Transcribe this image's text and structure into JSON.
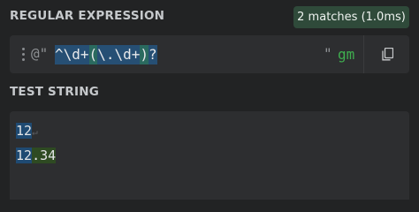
{
  "regex_section": {
    "label": "REGULAR EXPRESSION",
    "match_badge": "2 matches (1.0ms)",
    "delimiter_open": "@\"",
    "expression_tokens": [
      {
        "text": "^",
        "role": "anchor"
      },
      {
        "text": "\\d+",
        "role": "class"
      },
      {
        "text": "(",
        "role": "group"
      },
      {
        "text": "\\.",
        "role": "escape"
      },
      {
        "text": "\\d+",
        "role": "class"
      },
      {
        "text": ")",
        "role": "group"
      },
      {
        "text": "?",
        "role": "quantifier"
      }
    ],
    "delimiter_close": "\"",
    "flags": "gm",
    "copy_icon": "copy-icon"
  },
  "test_section": {
    "label": "TEST STRING",
    "line1_match": "12",
    "line1_newline_symbol": "↵",
    "line2_match_a": "12",
    "line2_match_b": ".34"
  },
  "colors": {
    "background": "#222324",
    "panel": "#2d2e30",
    "badge_bg": "#2f4a3a",
    "token_blue": "#264f74",
    "token_green": "#2a6a5f",
    "flags_green": "#3fae4f",
    "match_blue": "#1f4a72",
    "match_green": "#2e4a22"
  }
}
